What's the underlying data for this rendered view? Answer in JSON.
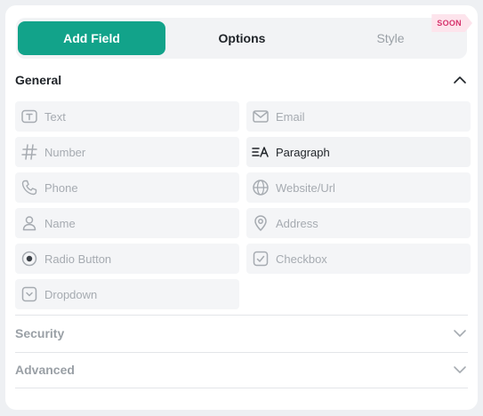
{
  "tabs": {
    "add_field": "Add Field",
    "options": "Options",
    "style": "Style",
    "style_badge": "SOON"
  },
  "sections": {
    "general": "General",
    "security": "Security",
    "advanced": "Advanced"
  },
  "fields": {
    "text": "Text",
    "email": "Email",
    "number": "Number",
    "paragraph": "Paragraph",
    "phone": "Phone",
    "website": "Website/Url",
    "name": "Name",
    "address": "Address",
    "radio": "Radio Button",
    "checkbox": "Checkbox",
    "dropdown": "Dropdown"
  },
  "colors": {
    "accent": "#12a38a",
    "badge": "#d6336c"
  },
  "icons": {
    "text": "text-box-icon",
    "email": "envelope-icon",
    "number": "hash-icon",
    "paragraph": "paragraph-icon",
    "phone": "phone-icon",
    "website": "globe-icon",
    "name": "user-icon",
    "address": "map-pin-icon",
    "radio": "radio-icon",
    "checkbox": "checkbox-icon",
    "dropdown": "dropdown-icon"
  }
}
